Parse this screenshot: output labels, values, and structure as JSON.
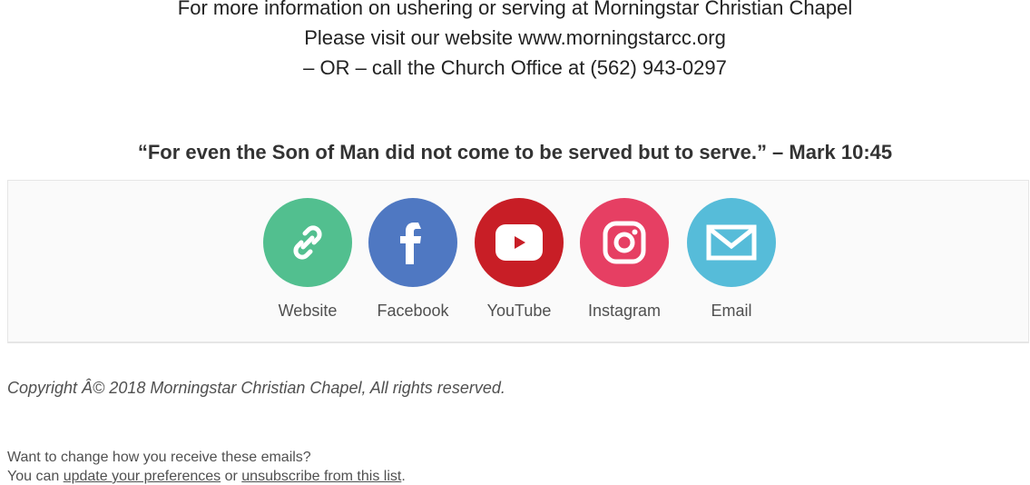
{
  "contact_info": {
    "line1": "For more information on ushering or serving at Morningstar Christian Chapel",
    "line2": "Please visit our website www.morningstarcc.org",
    "line3": "– OR – call the Church Office at (562) 943-0297"
  },
  "verse": "“For even the Son of Man did not come to be served but to serve.” – Mark 10:45",
  "social": {
    "items": [
      {
        "label": "Website",
        "icon": "link-icon",
        "color": "#52bf8f"
      },
      {
        "label": "Facebook",
        "icon": "facebook-icon",
        "color": "#4f78c2"
      },
      {
        "label": "YouTube",
        "icon": "youtube-icon",
        "color": "#c81e26"
      },
      {
        "label": "Instagram",
        "icon": "instagram-icon",
        "color": "#e63f63"
      },
      {
        "label": "Email",
        "icon": "mail-icon",
        "color": "#56bcd9"
      }
    ]
  },
  "copyright": "Copyright Â© 2018 Morningstar Christian Chapel, All rights reserved.",
  "footer": {
    "question": "Want to change how you receive these emails?",
    "prefix": "You can ",
    "update_link": "update your preferences",
    "middle": " or ",
    "unsubscribe_link": "unsubscribe from this list",
    "suffix": "."
  }
}
